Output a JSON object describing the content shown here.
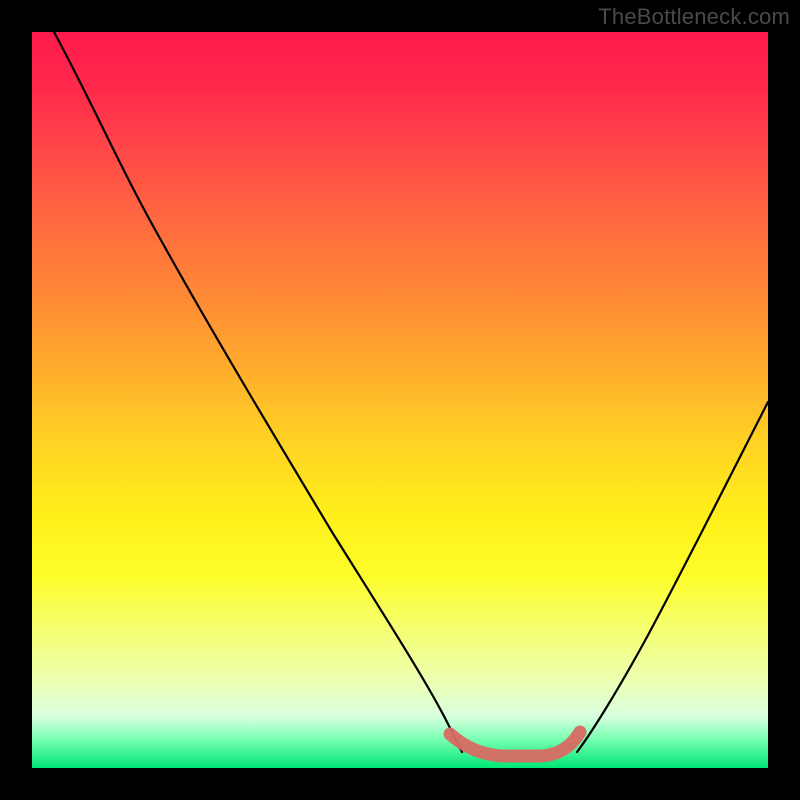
{
  "watermark": "TheBottleneck.com",
  "colors": {
    "background": "#000000",
    "gradient_top": "#ff1a4d",
    "gradient_bottom": "#00e676",
    "curve": "#000000",
    "marker": "#d86a63"
  },
  "chart_data": {
    "type": "line",
    "title": "",
    "xlabel": "",
    "ylabel": "",
    "xlim": [
      0,
      100
    ],
    "ylim": [
      0,
      100
    ],
    "series": [
      {
        "name": "left-curve",
        "x": [
          3,
          10,
          20,
          30,
          40,
          50,
          55,
          58
        ],
        "y": [
          100,
          87,
          70,
          53,
          36,
          17,
          7,
          3
        ]
      },
      {
        "name": "right-curve",
        "x": [
          74,
          80,
          86,
          92,
          100
        ],
        "y": [
          3,
          12,
          24,
          38,
          58
        ]
      },
      {
        "name": "valley-marker",
        "x": [
          57,
          60,
          64,
          68,
          72,
          74
        ],
        "y": [
          5,
          2.5,
          2,
          2,
          3,
          5
        ]
      }
    ],
    "annotations": [
      {
        "text": "TheBottleneck.com",
        "position": "top-right"
      }
    ]
  }
}
